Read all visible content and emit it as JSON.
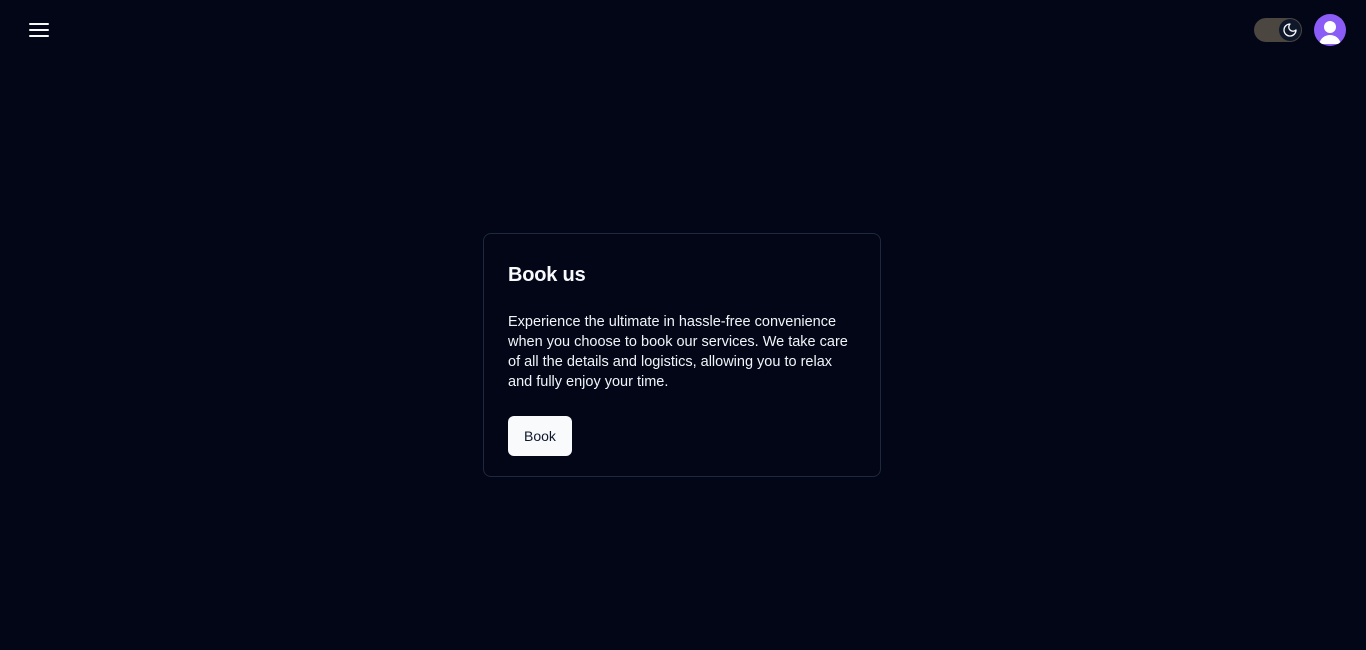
{
  "header": {
    "menu_icon": "hamburger-menu-icon",
    "theme_toggle": {
      "icon": "moon-icon",
      "state": "dark"
    },
    "avatar_icon": "user-icon"
  },
  "card": {
    "title": "Book us",
    "description": "Experience the ultimate in hassle-free convenience when you choose to book our services. We take care of all the details and logistics, allowing you to relax and fully enjoy your time.",
    "button_label": "Book"
  },
  "colors": {
    "background": "#020617",
    "card_border": "#1e293b",
    "toggle_track": "#4b4640",
    "avatar_bg": "#8b5cf6",
    "button_bg": "#f8fafc",
    "button_text": "#0f172a"
  }
}
